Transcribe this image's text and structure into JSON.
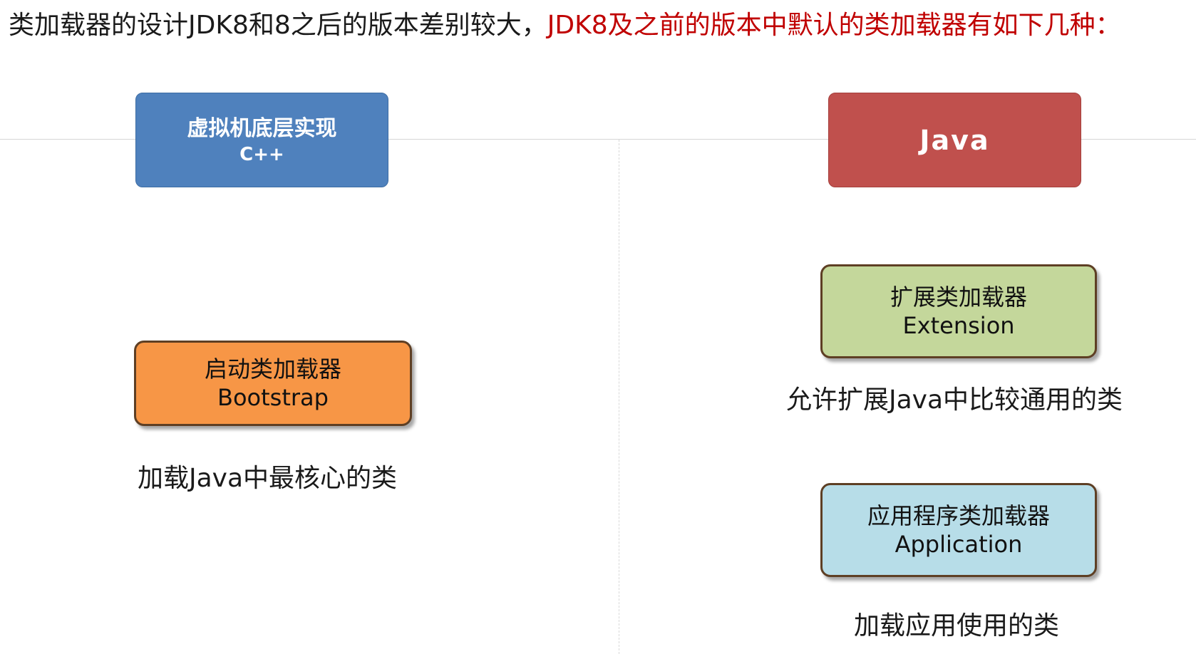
{
  "headline": {
    "part1": "类加载器的设计JDK8和8之后的版本差别较大，",
    "part2": "JDK8及之前的版本中默认的类加载器有如下几种："
  },
  "categories": {
    "native": {
      "line1": "虚拟机底层实现",
      "line2": "C++"
    },
    "java": {
      "line1": "Java"
    }
  },
  "loaders": {
    "bootstrap": {
      "line1": "启动类加载器",
      "line2": "Bootstrap",
      "desc": "加载Java中最核心的类"
    },
    "extension": {
      "line1": "扩展类加载器",
      "line2": "Extension",
      "desc": "允许扩展Java中比较通用的类"
    },
    "application": {
      "line1": "应用程序类加载器",
      "line2": "Application",
      "desc": "加载应用使用的类"
    }
  },
  "colors": {
    "headline_accent": "#c00000",
    "native_box": "#4f81bd",
    "java_box": "#c0504d",
    "bootstrap_box": "#f79646",
    "extension_box": "#c4d79b",
    "application_box": "#b7dde8",
    "loader_border": "#5e3f24"
  }
}
